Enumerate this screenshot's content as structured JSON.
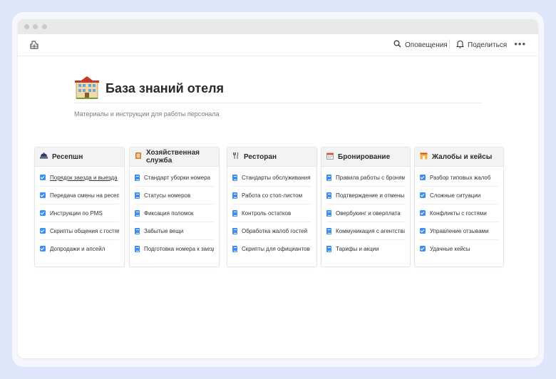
{
  "toolbar": {
    "notifications_label": "Оповещения",
    "share_label": "Поделиться",
    "more_label": "•••"
  },
  "page": {
    "title": "База знаний отеля",
    "subtitle": "Материалы и инструкции для работы персонала"
  },
  "cards": [
    {
      "icon": "reception-icon",
      "title": "Ресепшн",
      "item_icon": "checkbox",
      "items": [
        "Порядок заезда и выезда",
        "Передача смены на ресепшн",
        "Инструкции по PMS",
        "Скрипты общения с гостями",
        "Допродажи и апсейл"
      ]
    },
    {
      "icon": "housekeeping-icon",
      "title": "Хозяйственная служба",
      "item_icon": "document",
      "items": [
        "Стандарт уборки номера",
        "Статусы номеров",
        "Фиксация поломок",
        "Забытые вещи",
        "Подготовка номера к заезду"
      ]
    },
    {
      "icon": "utensils-icon",
      "title": "Ресторан",
      "item_icon": "document",
      "items": [
        "Стандарты обслуживания",
        "Работа со стоп-листом",
        "Контроль остатков",
        "Обработка жалоб гостей",
        "Скрипты для официантов"
      ]
    },
    {
      "icon": "calendar-icon",
      "title": "Бронирование",
      "item_icon": "document",
      "items": [
        "Правила работы с бронями",
        "Подтверждение и отмены",
        "Овербукинг и оверплата",
        "Коммуникация с агентствами",
        "Тарифы и акции"
      ]
    },
    {
      "icon": "complaints-icon",
      "title": "Жалобы и кейсы",
      "item_icon": "checkbox",
      "items": [
        "Разбор типовых жалоб",
        "Сложные ситуации",
        "Конфликты с гостями",
        "Управление отзывами",
        "Удачные кейсы"
      ]
    }
  ],
  "colors": {
    "accent": "#3f8ef5",
    "background": "#dfe6fb"
  }
}
